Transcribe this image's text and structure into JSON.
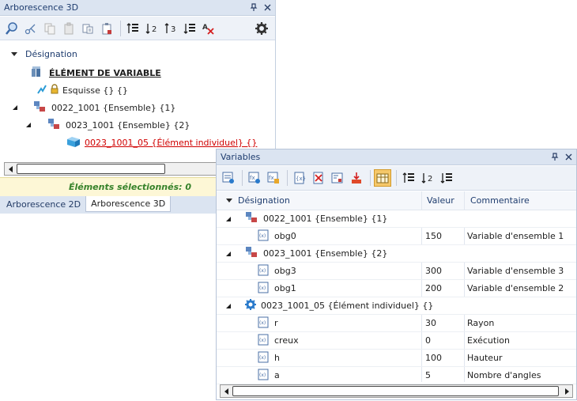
{
  "arbo": {
    "title": "Arborescence 3D",
    "header": "Désignation",
    "root_label": "ÉLÉMENT DE VARIABLE",
    "sketch_label": "Esquisse {} {}",
    "node1": "0022_1001 {Ensemble} {1}",
    "node2": "0023_1001 {Ensemble} {2}",
    "node3": "0023_1001_05 {Élément individuel} {}",
    "status": "Éléments sélectionnés: 0",
    "tabs": [
      "Arborescence 2D",
      "Arborescence 3D"
    ],
    "active_tab": "Arborescence 3D"
  },
  "vars": {
    "title": "Variables",
    "columns": {
      "designation": "Désignation",
      "value": "Valeur",
      "comment": "Commentaire"
    },
    "groups": [
      {
        "label": "0022_1001 {Ensemble} {1}",
        "rows": [
          {
            "name": "obg0",
            "value": "150",
            "comment": "Variable d'ensemble 1"
          }
        ]
      },
      {
        "label": "0023_1001 {Ensemble} {2}",
        "rows": [
          {
            "name": "obg3",
            "value": "300",
            "comment": "Variable d'ensemble 3"
          },
          {
            "name": "obg1",
            "value": "200",
            "comment": "Variable d'ensemble 2"
          }
        ]
      },
      {
        "label": "0023_1001_05 {Élément individuel} {}",
        "rows": [
          {
            "name": "r",
            "value": "30",
            "comment": "Rayon"
          },
          {
            "name": "creux",
            "value": "0",
            "comment": "Exécution"
          },
          {
            "name": "h",
            "value": "100",
            "comment": "Hauteur"
          },
          {
            "name": "a",
            "value": "5",
            "comment": "Nombre d'angles"
          }
        ]
      }
    ]
  },
  "colors": {
    "accent": "#dbe4f1",
    "status_text": "#36822a",
    "link_red": "#d00000",
    "active_tool": "#f5c86a"
  }
}
